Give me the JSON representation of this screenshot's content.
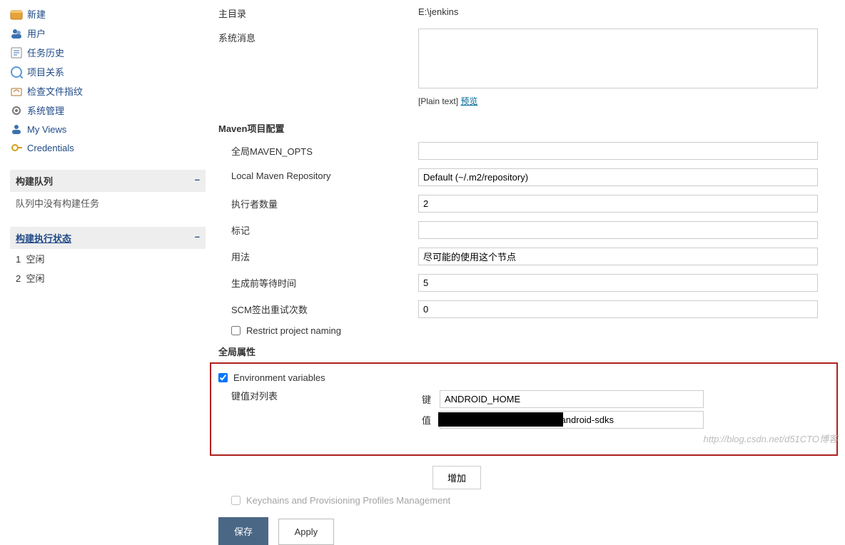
{
  "sidebar": {
    "items": [
      {
        "label": "新建",
        "icon": "new"
      },
      {
        "label": "用户",
        "icon": "users"
      },
      {
        "label": "任务历史",
        "icon": "history"
      },
      {
        "label": "项目关系",
        "icon": "relations"
      },
      {
        "label": "检查文件指纹",
        "icon": "fingerprint"
      },
      {
        "label": "系统管理",
        "icon": "manage"
      },
      {
        "label": "My Views",
        "icon": "views"
      },
      {
        "label": "Credentials",
        "icon": "creds"
      }
    ],
    "queue": {
      "title": "构建队列",
      "empty": "队列中没有构建任务",
      "collapse": "–"
    },
    "exec": {
      "title": "构建执行状态",
      "collapse": "–",
      "rows": [
        {
          "n": "1",
          "state": "空闲"
        },
        {
          "n": "2",
          "state": "空闲"
        }
      ]
    }
  },
  "config": {
    "home_dir_label": "主目录",
    "home_dir_value": "E:\\jenkins",
    "sys_msg_label": "系统消息",
    "plain_text": "[Plain text]",
    "preview": "预览",
    "maven_section": "Maven项目配置",
    "global_mvn_opts": "全局MAVEN_OPTS",
    "local_mvn_repo": "Local Maven Repository",
    "local_mvn_repo_value": "Default (~/.m2/repository)",
    "executors_label": "执行者数量",
    "executors_value": "2",
    "labels_label": "标记",
    "usage_label": "用法",
    "usage_value": "尽可能的使用这个节点",
    "quiet_label": "生成前等待时间",
    "quiet_value": "5",
    "scm_retry_label": "SCM签出重试次数",
    "scm_retry_value": "0",
    "restrict_label": "Restrict project naming",
    "global_props": "全局属性",
    "env_vars_label": "Environment variables",
    "kv_list_label": "键值对列表",
    "key_label": "键",
    "value_label": "值",
    "key_value": "ANDROID_HOME",
    "value_value": "                                   idSdk\\android-sdks",
    "add_button": "增加",
    "keychains_label": "Keychains and Provisioning Profiles Management",
    "save_button": "保存",
    "apply_button": "Apply"
  },
  "watermark": "http://blog.csdn.net/d51CTO博客"
}
